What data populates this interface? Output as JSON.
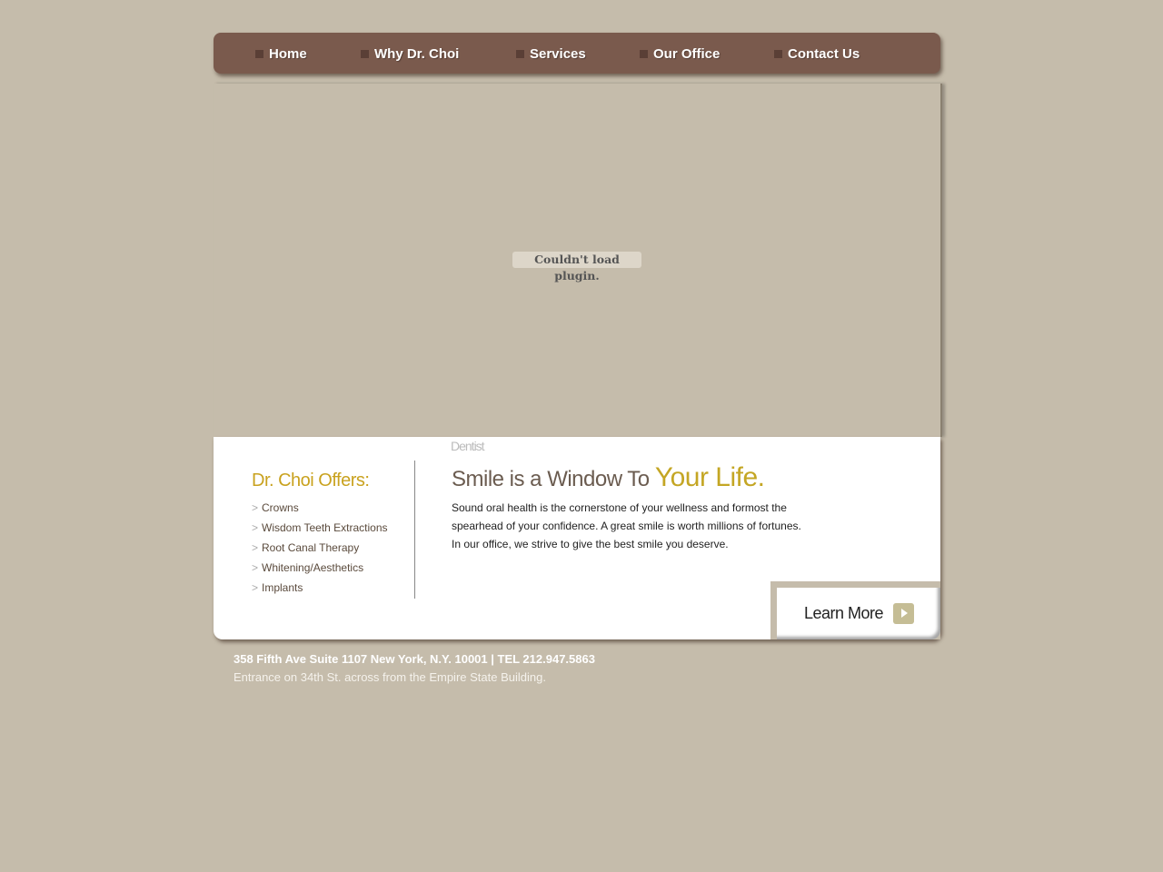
{
  "nav": {
    "items": [
      {
        "label": "Home"
      },
      {
        "label": "Why Dr. Choi"
      },
      {
        "label": "Services"
      },
      {
        "label": "Our Office"
      },
      {
        "label": "Contact Us"
      }
    ]
  },
  "plugin": {
    "message": "Couldn't load plugin."
  },
  "panel": {
    "dentist_label": "Dentist",
    "offers_title": "Dr. Choi Offers:",
    "offers_marker": ">",
    "offers": [
      "Crowns",
      "Wisdom Teeth Extractions",
      "Root Canal Therapy",
      "Whitening/Aesthetics",
      "Implants"
    ],
    "headline": "Smile is a Window To ",
    "headline_highlight": "Your Life.",
    "body_lines": [
      "Sound oral health is the cornerstone of your wellness and formost the",
      "spearhead of your confidence. A great smile is worth millions of fortunes.",
      "In our office, we strive to give the best smile you deserve."
    ],
    "learn_more": "Learn More"
  },
  "footer": {
    "address": "358 Fifth Ave Suite 1107 New York, N.Y. 10001 | TEL 212.947.5863",
    "entrance": "Entrance on 34th St. across from the Empire State Building."
  },
  "colors": {
    "background": "#c5bcab",
    "nav": "#7a5a4d",
    "accent": "#c4a624"
  }
}
